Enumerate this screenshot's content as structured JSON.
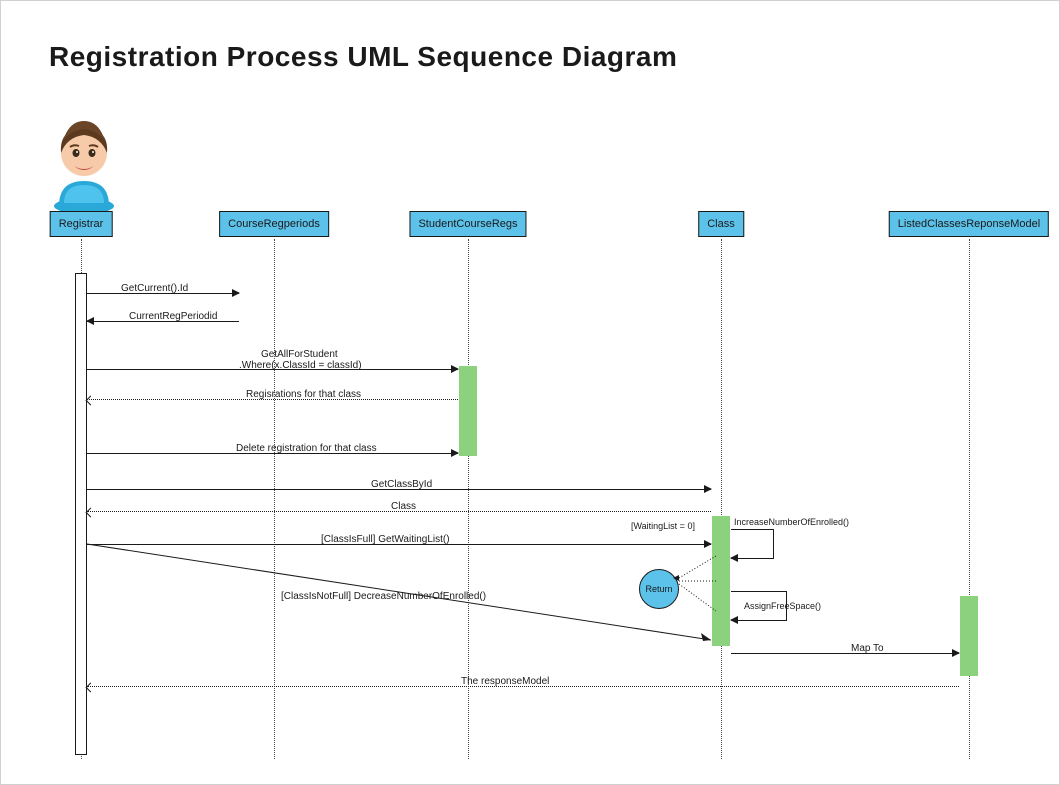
{
  "title": "Registration Process UML Sequence Diagram",
  "lifelines": {
    "registrar": "Registrar",
    "crp": "CourseRegperiods",
    "scr": "StudentCourseRegs",
    "cls": "Class",
    "model": "ListedClassesReponseModel"
  },
  "messages": {
    "getCurrent": "GetCurrent().Id",
    "currentPeriod": "CurrentRegPeriodid",
    "getAllLine1": "GetAllForStudent",
    "getAllLine2": ".Where(x.ClassId = classId)",
    "regsForClass": "Regisrations for that class",
    "deleteReg": "Delete registration for that class",
    "getClassById": "GetClassById",
    "classReturn": "Class",
    "waitingListZero": "[WaitingList = 0]",
    "increaseEnrolled": "IncreaseNumberOfEnrolled()",
    "classIsFull": "[ClassIsFull] GetWaitingList()",
    "assignFree": "AssignFreeSpace()",
    "classNotFull": "[ClassIsNotFull] DecreaseNumberOfEnrolled()",
    "return": "Return",
    "mapTo": "Map To",
    "responseModel": "The responseModel"
  }
}
